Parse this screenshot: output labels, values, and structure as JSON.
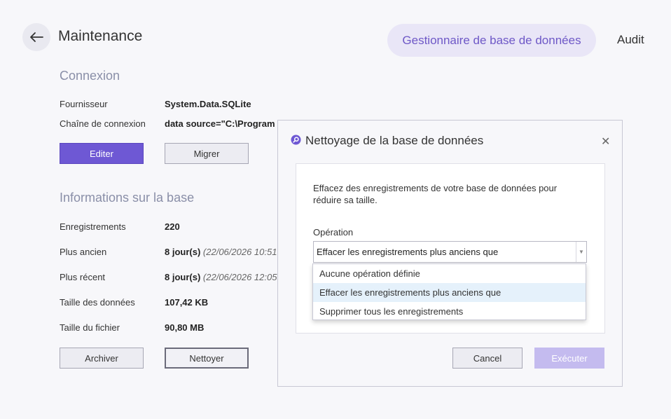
{
  "header": {
    "title": "Maintenance",
    "tabs": [
      {
        "label": "Gestionnaire de base de données",
        "active": true
      },
      {
        "label": "Audit",
        "active": false
      }
    ]
  },
  "connection": {
    "section_title": "Connexion",
    "provider_label": "Fournisseur",
    "provider_value": "System.Data.SQLite",
    "connstr_label": "Chaîne de connexion",
    "connstr_value": "data source=\"C:\\Program",
    "edit_button": "Editer",
    "migrate_button": "Migrer"
  },
  "dbinfo": {
    "section_title": "Informations sur la base",
    "rows": [
      {
        "label": "Enregistrements",
        "value": "220",
        "date": ""
      },
      {
        "label": "Plus ancien",
        "value": "8 jour(s)",
        "date": "(22/06/2026 10:51"
      },
      {
        "label": "Plus récent",
        "value": "8 jour(s)",
        "date": "(22/06/2026 12:05"
      },
      {
        "label": "Taille des données",
        "value": "107,42 KB",
        "date": ""
      },
      {
        "label": "Taille du fichier",
        "value": "90,80 MB",
        "date": ""
      }
    ],
    "archive_button": "Archiver",
    "clean_button": "Nettoyer"
  },
  "dialog": {
    "title": "Nettoyage de la base de données",
    "close_icon": "close-icon",
    "description": "Effacez des enregistrements de votre base de données pour réduire sa taille.",
    "operation_label": "Opération",
    "operation_value": "Effacer les enregistrements plus anciens que",
    "options": [
      "Aucune opération définie",
      "Effacer les enregistrements plus anciens que",
      "Supprimer tous les enregistrements"
    ],
    "selected_option_index": 1,
    "cancel_button": "Cancel",
    "execute_button": "Exécuter"
  },
  "colors": {
    "accent": "#6e58d4",
    "accent_soft": "#e9e6f7",
    "muted_heading": "#8a8fa8",
    "dropdown_highlight": "#e5f1fb"
  }
}
